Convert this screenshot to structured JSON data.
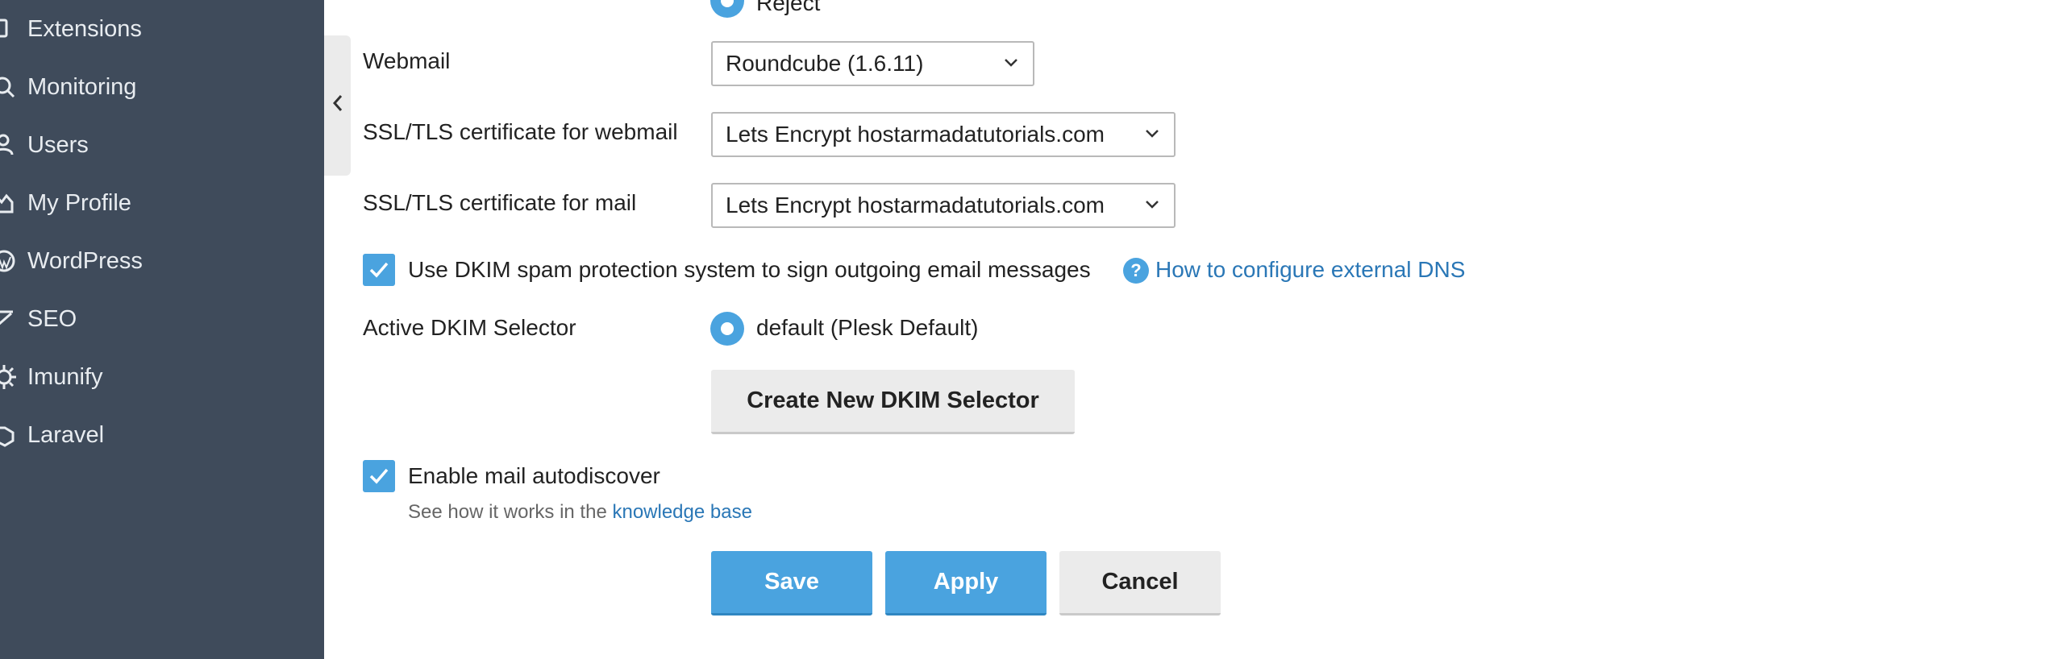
{
  "sidebar": {
    "items": [
      {
        "label": "Extensions",
        "icon": "extensions-icon"
      },
      {
        "label": "Monitoring",
        "icon": "monitoring-icon"
      },
      {
        "label": "Users",
        "icon": "user-icon"
      },
      {
        "label": "My Profile",
        "icon": "profile-icon"
      },
      {
        "label": "WordPress",
        "icon": "wordpress-icon"
      },
      {
        "label": "SEO",
        "icon": "seo-icon"
      },
      {
        "label": "Imunify",
        "icon": "imunify-icon"
      },
      {
        "label": "Laravel",
        "icon": "laravel-icon"
      }
    ],
    "background": "#3f4b5b"
  },
  "form": {
    "reject_option": "Reject",
    "webmail_label": "Webmail",
    "webmail_value": "Roundcube (1.6.11)",
    "ssl_webmail_label": "SSL/TLS certificate for webmail",
    "ssl_webmail_value": "Lets Encrypt hostarmadatutorials.com",
    "ssl_mail_label": "SSL/TLS certificate for mail",
    "ssl_mail_value": "Lets Encrypt hostarmadatutorials.com",
    "dkim_checkbox_label": "Use DKIM spam protection system to sign outgoing email messages",
    "dkim_help_link": "How to configure external DNS",
    "active_dkim_label": "Active DKIM Selector",
    "dkim_selector_option": "default (Plesk Default)",
    "create_dkim_button": "Create New DKIM Selector",
    "autodiscover_label": "Enable mail autodiscover",
    "autodiscover_hint_prefix": "See how it works in the",
    "autodiscover_hint_link": "knowledge base",
    "dkim_checked": true,
    "autodiscover_checked": true
  },
  "actions": {
    "save": "Save",
    "apply": "Apply",
    "cancel": "Cancel"
  },
  "colors": {
    "accent": "#4aa3df",
    "link": "#2a77b6"
  }
}
